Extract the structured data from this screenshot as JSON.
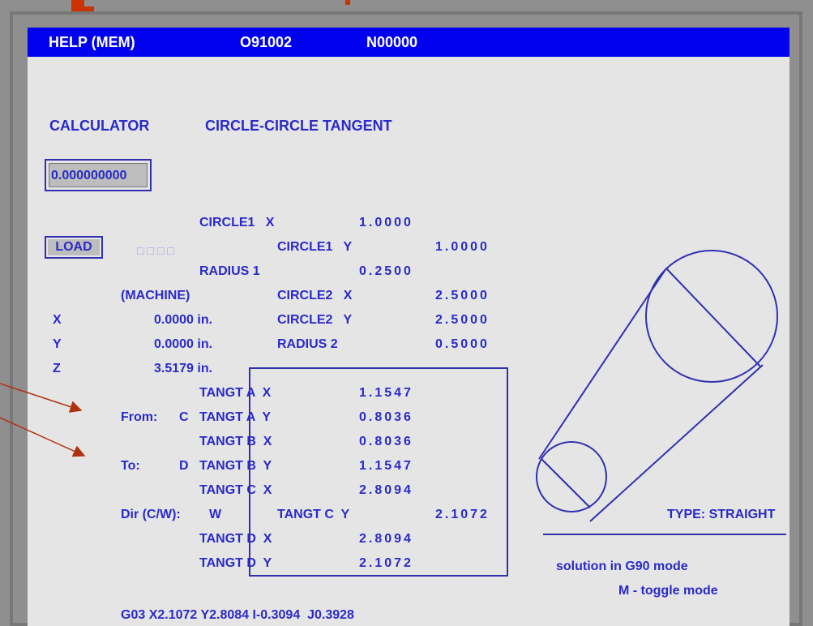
{
  "header": {
    "mode": "HELP (MEM)",
    "program": "O91002",
    "sequence": "N00000"
  },
  "title": {
    "calculator": "CALCULATOR",
    "function": "CIRCLE-CIRCLE TANGENT"
  },
  "result_value": "0.000000000",
  "load_label": "LOAD",
  "glyph_placeholder": "□□□□",
  "inputs": [
    {
      "label": "CIRCLE1   X",
      "value": "1.0000"
    },
    {
      "label": "CIRCLE1   Y",
      "value": "1.0000"
    },
    {
      "label": "RADIUS 1",
      "value": "0.2500"
    },
    {
      "label": "CIRCLE2   X",
      "value": "2.5000"
    },
    {
      "label": "CIRCLE2   Y",
      "value": "2.5000"
    },
    {
      "label": "RADIUS 2",
      "value": "0.5000"
    }
  ],
  "machine": {
    "label": "(MACHINE)",
    "axes": [
      {
        "axis": "X",
        "value": "0.0000 in."
      },
      {
        "axis": "Y",
        "value": "0.0000 in."
      },
      {
        "axis": "Z",
        "value": "3.5179 in."
      }
    ]
  },
  "tangents": [
    {
      "label": "TANGT A  X",
      "value": "1.1547"
    },
    {
      "label": "TANGT A  Y",
      "value": "0.8036"
    },
    {
      "label": "TANGT B  X",
      "value": "0.8036"
    },
    {
      "label": "TANGT B  Y",
      "value": "1.1547"
    },
    {
      "label": "TANGT C  X",
      "value": "2.8094"
    },
    {
      "label": "TANGT C  Y",
      "value": "2.1072"
    },
    {
      "label": "TANGT D  X",
      "value": "2.8094"
    },
    {
      "label": "TANGT D  Y",
      "value": "2.1072"
    }
  ],
  "from": {
    "label": "From:",
    "value": "C"
  },
  "to": {
    "label": "To:",
    "value": "D"
  },
  "direction": {
    "label": "Dir (C/W):",
    "value": "W"
  },
  "type_label": "TYPE: STRAIGHT",
  "solution_mode": "solution in G90 mode",
  "toggle_hint": "M - toggle mode",
  "gcode": "G03 X2.1072 Y2.8084 I-0.3094  J0.3928",
  "colors": {
    "titlebar": "#0000ee",
    "text": "#2a2ac8",
    "panel": "#e5e5e5",
    "arrow": "#b03010"
  }
}
